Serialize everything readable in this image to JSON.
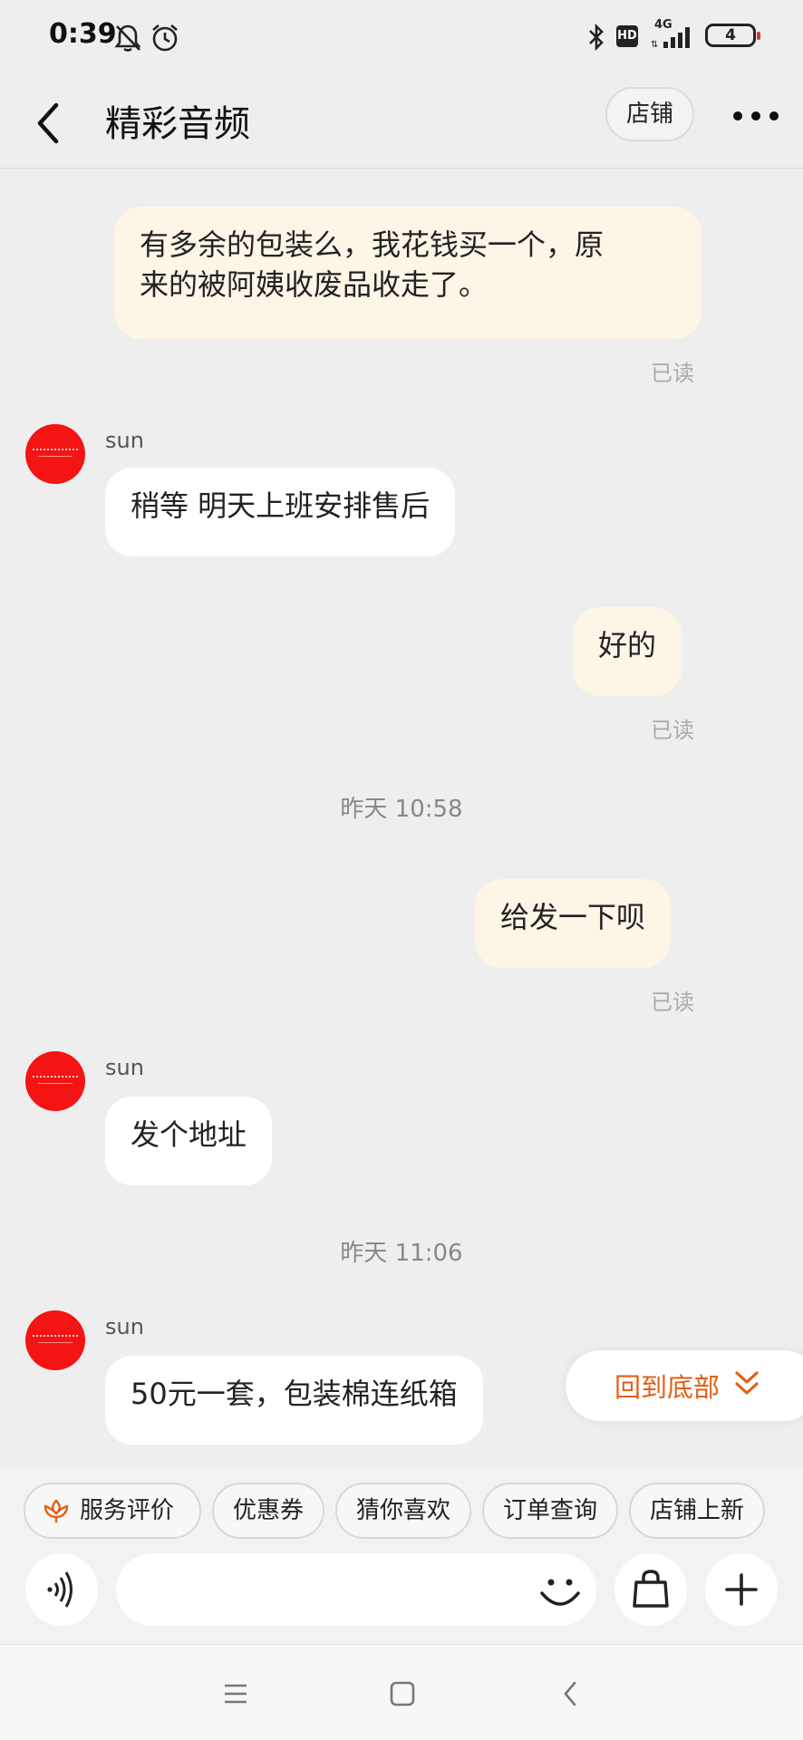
{
  "status_bar": {
    "time": "0:39",
    "network": "4G",
    "hd_badge": "HD",
    "battery": "4",
    "icons": [
      "bell-off-icon",
      "alarm-icon",
      "bluetooth-icon",
      "hd-icon",
      "signal-icon",
      "battery-icon"
    ]
  },
  "header": {
    "title": "精彩音频",
    "shop_button": "店铺"
  },
  "messages": [
    {
      "from": "me",
      "text_line1": "有多余的包装么，我花钱买一个，原",
      "text_line2": "来的被阿姨收废品收走了。",
      "status": "已读"
    },
    {
      "from": "them",
      "sender": "sun",
      "text": "稍等 明天上班安排售后"
    },
    {
      "from": "me",
      "text": "好的",
      "status": "已读"
    },
    {
      "timestamp": "昨天  10:58"
    },
    {
      "from": "me",
      "text": "给发一下呗",
      "status": "已读"
    },
    {
      "from": "them",
      "sender": "sun",
      "text": "发个地址"
    },
    {
      "timestamp": "昨天  11:06"
    },
    {
      "from": "them",
      "sender": "sun",
      "text": "50元一套，包装棉连纸箱"
    }
  ],
  "scroll_to_bottom": {
    "label": "回到底部",
    "color": "#e35f12"
  },
  "quick_chips": [
    "服务评价",
    "优惠券",
    "猜你喜欢",
    "订单查询",
    "店铺上新"
  ],
  "input": {
    "value": "",
    "placeholder": ""
  },
  "colors": {
    "my_bubble": "#fdf5e6",
    "their_bubble": "#ffffff",
    "avatar": "#f41414",
    "background": "#eeeeee"
  }
}
